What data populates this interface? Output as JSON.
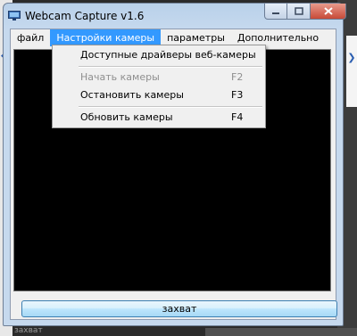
{
  "window": {
    "title": "Webcam Capture v1.6"
  },
  "menubar": {
    "items": [
      "файл",
      "Настройки камеры",
      "параметры",
      "Дополнительно"
    ]
  },
  "dropdown": {
    "items": [
      {
        "label": "Доступные драйверы веб-камеры",
        "shortcut": ""
      },
      {
        "label": "Начать камеры",
        "shortcut": "F2"
      },
      {
        "label": "Остановить камеры",
        "shortcut": "F3"
      },
      {
        "label": "Обновить камеры",
        "shortcut": "F4"
      }
    ]
  },
  "capture_button": {
    "label": "захват"
  },
  "background": {
    "bottom_text": "захват"
  }
}
